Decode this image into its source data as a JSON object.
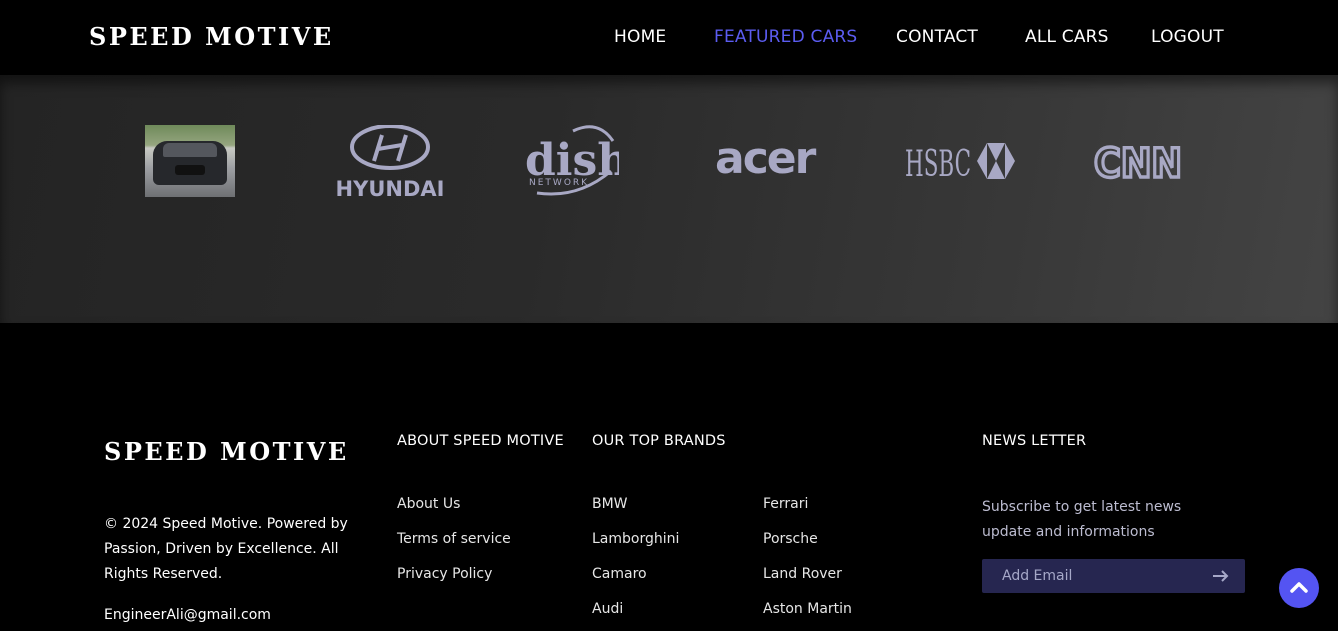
{
  "nav": {
    "brand": "SPEED MOTIVE",
    "links": [
      {
        "label": "HOME",
        "active": false
      },
      {
        "label": "FEATURED CARS",
        "active": true
      },
      {
        "label": "CONTACT",
        "active": false
      },
      {
        "label": "ALL CARS",
        "active": false
      },
      {
        "label": "LOGOUT",
        "active": false
      }
    ]
  },
  "brand_strip": {
    "logos": [
      {
        "icon": "car-photo"
      },
      {
        "icon": "hyundai-logo",
        "text": "HYUNDAI"
      },
      {
        "icon": "dish-network-logo",
        "text": "dish",
        "subtext": "NETWORK"
      },
      {
        "icon": "acer-logo",
        "text": "acer"
      },
      {
        "icon": "hsbc-logo",
        "text": "HSBC"
      },
      {
        "icon": "cnn-logo",
        "text": "CNN"
      }
    ]
  },
  "footer": {
    "brand": "SPEED MOTIVE",
    "copyright": "© 2024 Speed Motive. Powered by Passion, Driven by Excellence. All Rights Reserved.",
    "email": "EngineerAli@gmail.com",
    "about": {
      "heading": "ABOUT SPEED MOTIVE",
      "links": [
        "About Us",
        "Terms of service",
        "Privacy Policy"
      ]
    },
    "brands": {
      "heading": "OUR TOP BRANDS",
      "col1": [
        "BMW",
        "Lamborghini",
        "Camaro",
        "Audi"
      ],
      "col2": [
        "Ferrari",
        "Porsche",
        "Land Rover",
        "Aston Martin"
      ]
    },
    "newsletter": {
      "heading": "NEWS LETTER",
      "description": "Subscribe to get latest news update and informations",
      "placeholder": "Add Email",
      "submit_icon": "arrow-right-icon"
    }
  },
  "colors": {
    "accent": "#5b5cf0",
    "logo_tint": "#a8a8c4",
    "input_bg": "#262650"
  },
  "back_to_top_icon": "chevron-up-icon"
}
